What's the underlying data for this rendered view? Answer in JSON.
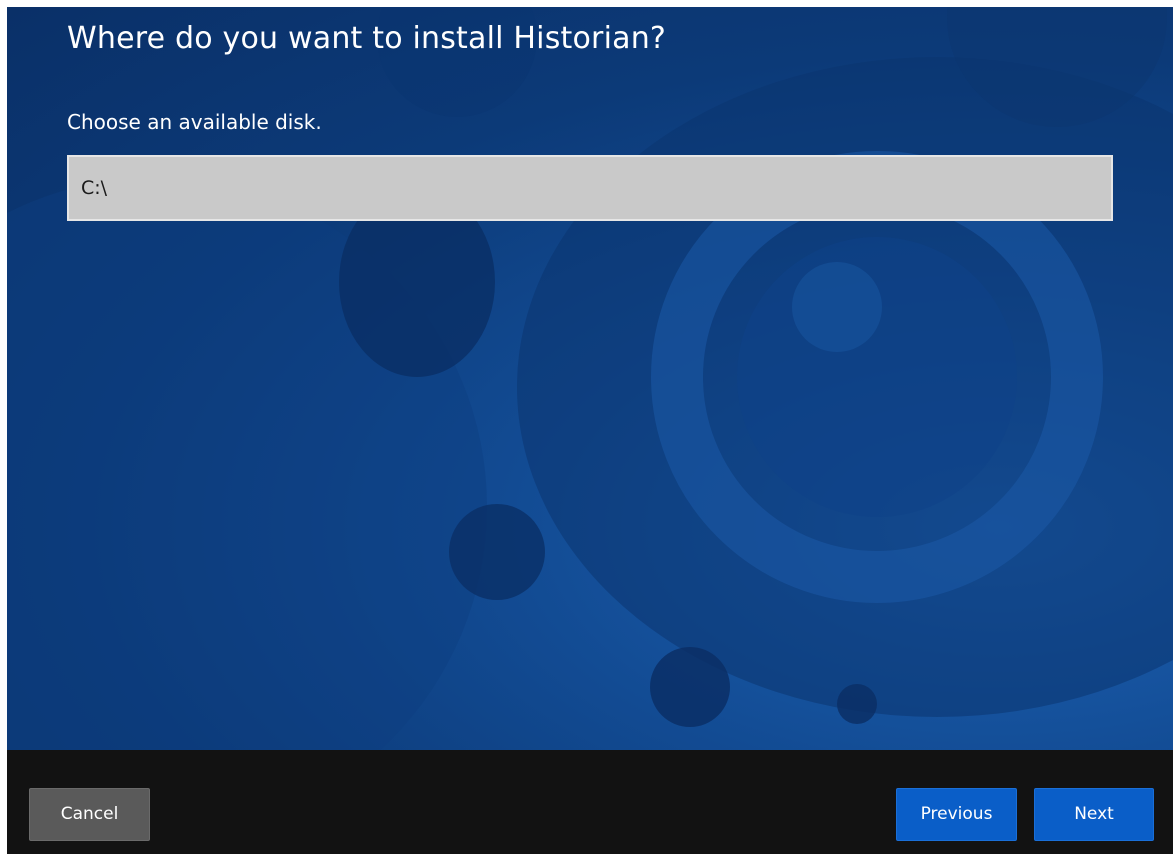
{
  "installer": {
    "title": "Where do you want to install Historian?",
    "subtitle": "Choose an available disk.",
    "disk_select": {
      "value": "C:\\"
    }
  },
  "footer": {
    "cancel_label": "Cancel",
    "previous_label": "Previous",
    "next_label": "Next"
  },
  "colors": {
    "background_blue": "#0c3a78",
    "accent_blue": "#0a5ec8",
    "footer_black": "#121212",
    "cancel_gray": "#5a5a5a",
    "field_gray": "#c9c9c9"
  }
}
